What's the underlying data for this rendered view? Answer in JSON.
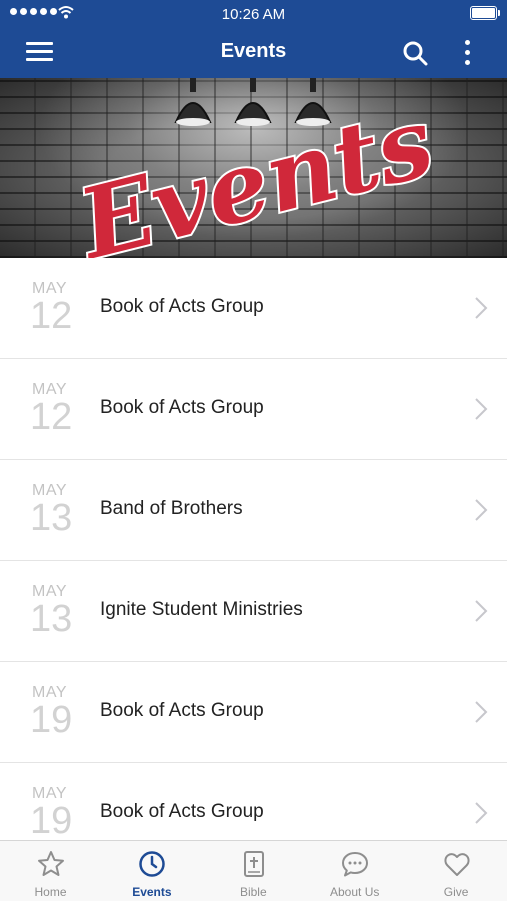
{
  "status_bar": {
    "time": "10:26 AM"
  },
  "header": {
    "title": "Events"
  },
  "banner": {
    "text": "Events"
  },
  "events": [
    {
      "month": "MAY",
      "day": "12",
      "title": "Book of Acts Group"
    },
    {
      "month": "MAY",
      "day": "12",
      "title": "Book of Acts Group"
    },
    {
      "month": "MAY",
      "day": "13",
      "title": "Band of Brothers"
    },
    {
      "month": "MAY",
      "day": "13",
      "title": "Ignite Student Ministries"
    },
    {
      "month": "MAY",
      "day": "19",
      "title": "Book of Acts Group"
    },
    {
      "month": "MAY",
      "day": "19",
      "title": "Book of Acts Group"
    }
  ],
  "tabs": [
    {
      "label": "Home",
      "icon": "star-icon"
    },
    {
      "label": "Events",
      "icon": "clock-icon",
      "active": true
    },
    {
      "label": "Bible",
      "icon": "bible-icon"
    },
    {
      "label": "About Us",
      "icon": "speech-bubble-icon"
    },
    {
      "label": "Give",
      "icon": "heart-icon"
    }
  ],
  "colors": {
    "header": "#1e4b95",
    "banner_text": "#d0283a",
    "active_tab": "#1e4b95",
    "inactive_tab": "#8e8e8e"
  }
}
